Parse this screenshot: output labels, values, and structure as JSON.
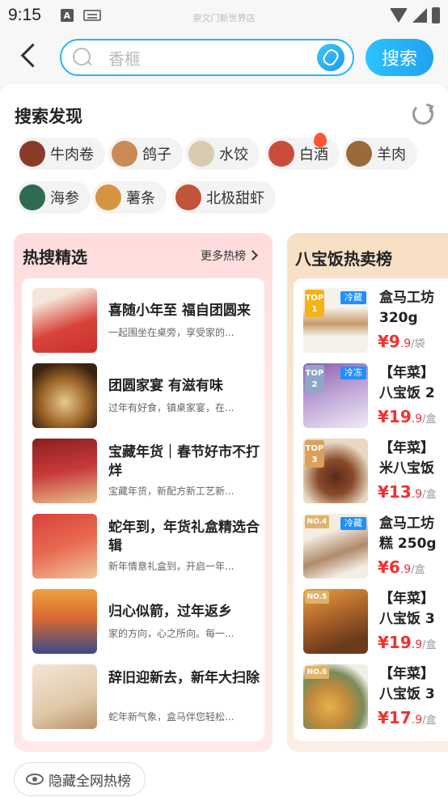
{
  "status": {
    "time": "9:15",
    "store": "崇文门新世界店"
  },
  "search": {
    "placeholder": "香榧",
    "button_label": "搜索"
  },
  "discover": {
    "title": "搜索发现",
    "chips": [
      {
        "label": "牛肉卷",
        "hot": false,
        "color": "#8a3b2a"
      },
      {
        "label": "鸽子",
        "hot": false,
        "color": "#c98a56"
      },
      {
        "label": "水饺",
        "hot": false,
        "color": "#d9cbb0"
      },
      {
        "label": "白酒",
        "hot": true,
        "color": "#c94c3c"
      },
      {
        "label": "羊肉",
        "hot": false,
        "color": "#9a6b3a"
      },
      {
        "label": "海参",
        "hot": false,
        "color": "#2e6b52"
      },
      {
        "label": "薯条",
        "hot": false,
        "color": "#d59540"
      },
      {
        "label": "北极甜虾",
        "hot": false,
        "color": "#c0553a"
      }
    ]
  },
  "hot": {
    "title": "热搜精选",
    "more_label": "更多热榜",
    "items": [
      {
        "name": "喜随小年至 福自团圆来",
        "desc": "一起围坐在桌旁，享受家的...",
        "color": "#d8433a"
      },
      {
        "name": "团圆家宴 有滋有味",
        "desc": "过年有好食，镇桌家宴，在...",
        "color": "#7a4a20"
      },
      {
        "name": "宝藏年货｜春节好市不打烊",
        "desc": "宝藏年货，新配方新工艺新...",
        "color": "#b02a2a"
      },
      {
        "name": "蛇年到，年货礼盒精选合辑",
        "desc": "新年情意礼盒到，开启一年...",
        "color": "#c8423a"
      },
      {
        "name": "归心似箭，过年返乡",
        "desc": "家的方向，心之所向。每一...",
        "color": "#d98c3a"
      },
      {
        "name": "辞旧迎新去，新年大扫除",
        "desc": "蛇年新气象，盒马伴您轻松...",
        "color": "#e8d6c0"
      }
    ]
  },
  "rank": {
    "title": "八宝饭热卖榜",
    "items": [
      {
        "badge": "TOP 1",
        "tag": "冷藏",
        "name1": "盒马工坊",
        "name2": "320g",
        "price_int": "¥9",
        "price_dec": ".9",
        "unit": "/袋",
        "badge_color": "#f5b316"
      },
      {
        "badge": "TOP 2",
        "tag": "冷冻",
        "name1": "【年菜】",
        "name2": "八宝饭 2",
        "price_int": "¥19",
        "price_dec": ".9",
        "unit": "/盒",
        "badge_color": "#8fa6c8"
      },
      {
        "badge": "TOP 3",
        "tag": "",
        "name1": "【年菜】",
        "name2": "米八宝饭",
        "price_int": "¥13",
        "price_dec": ".9",
        "unit": "/盒",
        "badge_color": "#d9a15a"
      },
      {
        "badge": "NO.4",
        "tag": "冷藏",
        "name1": "盒马工坊",
        "name2": "糕 250g",
        "price_int": "¥6",
        "price_dec": ".9",
        "unit": "/盒",
        "badge_color": "#e0b36a"
      },
      {
        "badge": "NO.5",
        "tag": "",
        "name1": "【年菜】",
        "name2": "八宝饭 3",
        "price_int": "¥19",
        "price_dec": ".9",
        "unit": "/盒",
        "badge_color": "#e0b36a"
      },
      {
        "badge": "NO.6",
        "tag": "",
        "name1": "【年菜】",
        "name2": "八宝饭 3",
        "price_int": "¥17",
        "price_dec": ".9",
        "unit": "/盒",
        "badge_color": "#e0b36a"
      }
    ]
  },
  "footer": {
    "hide_label": "隐藏全网热榜"
  }
}
